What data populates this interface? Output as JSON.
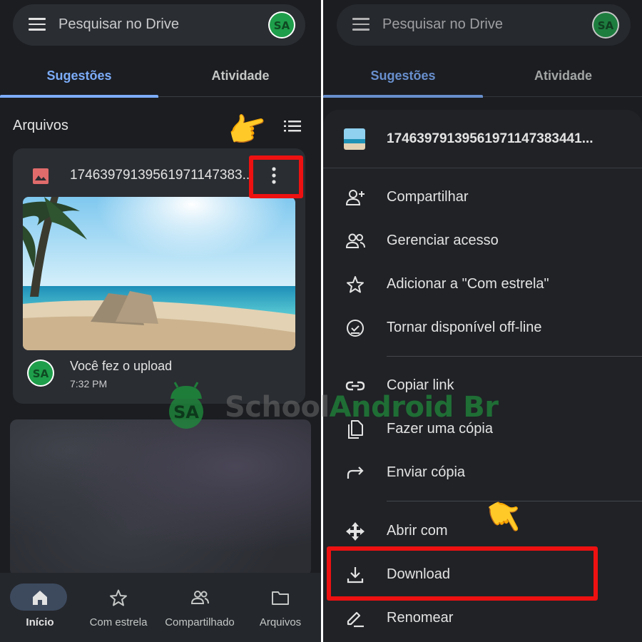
{
  "left": {
    "search": {
      "placeholder": "Pesquisar no Drive"
    },
    "tabs": [
      {
        "label": "Sugestões",
        "active": true
      },
      {
        "label": "Atividade",
        "active": false
      }
    ],
    "section_title": "Arquivos",
    "file_card": {
      "file_name": "17463979139561971147383...",
      "activity": "Você fez o upload",
      "time": "7:32 PM"
    },
    "bottom_nav": [
      {
        "label": "Início",
        "icon": "home-icon",
        "active": true
      },
      {
        "label": "Com estrela",
        "icon": "star-icon",
        "active": false
      },
      {
        "label": "Compartilhado",
        "icon": "shared-icon",
        "active": false
      },
      {
        "label": "Arquivos",
        "icon": "folder-icon",
        "active": false
      }
    ]
  },
  "right": {
    "search": {
      "placeholder": "Pesquisar no Drive"
    },
    "tabs": [
      {
        "label": "Sugestões",
        "active": true
      },
      {
        "label": "Atividade",
        "active": false
      }
    ],
    "sheet_title": "17463979139561971147383441...",
    "menu": [
      {
        "label": "Compartilhar",
        "icon": "person-add-icon"
      },
      {
        "label": "Gerenciar acesso",
        "icon": "people-icon"
      },
      {
        "label": "Adicionar a \"Com estrela\"",
        "icon": "star-outline-icon"
      },
      {
        "label": "Tornar disponível off-line",
        "icon": "offline-check-icon"
      },
      {
        "label": "Copiar link",
        "icon": "link-icon"
      },
      {
        "label": "Fazer uma cópia",
        "icon": "copy-icon"
      },
      {
        "label": "Enviar cópia",
        "icon": "share-arrow-icon"
      },
      {
        "label": "Abrir com",
        "icon": "open-with-icon"
      },
      {
        "label": "Download",
        "icon": "download-icon"
      },
      {
        "label": "Renomear",
        "icon": "rename-icon"
      }
    ]
  },
  "watermark": {
    "part1": "School",
    "part2": "Android Br"
  },
  "colors": {
    "accent": "#7cacf8",
    "highlight": "#ee1111",
    "background": "#1b1d21"
  }
}
